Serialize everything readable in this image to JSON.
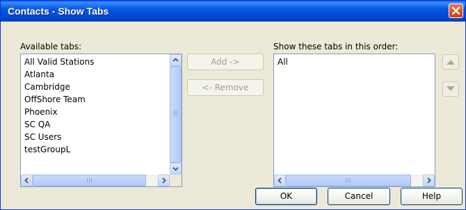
{
  "window": {
    "title": "Contacts - Show Tabs"
  },
  "available": {
    "label": "Available tabs:",
    "items": [
      "All Valid Stations",
      "Atlanta",
      "Cambridge",
      "OffShore Team",
      "Phoenix",
      "SC QA",
      "SC Users",
      "testGroupL"
    ]
  },
  "shown": {
    "label": "Show these tabs in this order:",
    "items": [
      "All"
    ]
  },
  "buttons": {
    "add": "Add ->",
    "remove": "<- Remove",
    "ok": "OK",
    "cancel": "Cancel",
    "help": "Help"
  },
  "icons": {
    "close": "close-icon",
    "move_up": "triangle-up-icon",
    "move_down": "triangle-down-icon",
    "scroll_up": "chevron-up-icon",
    "scroll_down": "chevron-down-icon",
    "scroll_left": "chevron-left-icon",
    "scroll_right": "chevron-right-icon"
  },
  "colors": {
    "titlebar": "#0458e0",
    "dialog_bg": "#ece9d8",
    "close_button": "#d8532d",
    "listbox_border": "#7f9db9"
  }
}
